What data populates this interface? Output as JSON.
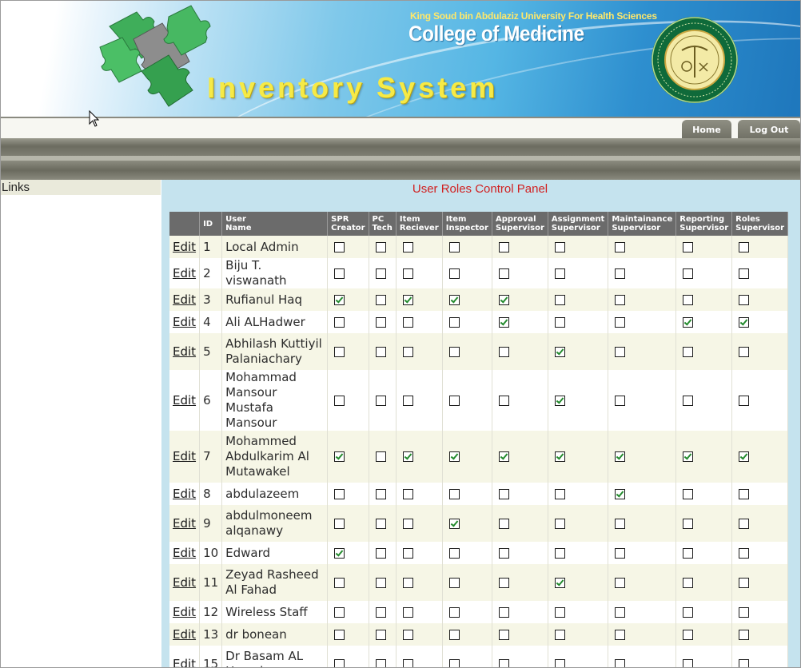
{
  "header": {
    "university": "King Soud bin Abdulaziz University For Health Sciences",
    "college": "College of Medicine",
    "system_title": "Inventory System",
    "logo_icon": "puzzle-pieces-icon",
    "seal_icon": "university-seal-icon"
  },
  "nav": {
    "tabs": [
      {
        "label": "Home"
      },
      {
        "label": "Log Out"
      }
    ]
  },
  "sidebar": {
    "title": "Links"
  },
  "main": {
    "title": "User Roles Control Panel",
    "columns": [
      "",
      "ID",
      "User Name",
      "SPR Creator",
      "PC Tech",
      "Item Reciever",
      "Item Inspector",
      "Approval Supervisor",
      "Assignment Supervisor",
      "Maintainance Supervisor",
      "Reporting Supervisor",
      "Roles Supervisor"
    ],
    "edit_label": "Edit",
    "rows": [
      {
        "id": "1",
        "name": "Local Admin",
        "roles": [
          0,
          0,
          0,
          0,
          0,
          0,
          0,
          0,
          0
        ]
      },
      {
        "id": "2",
        "name": "Biju T. viswanath",
        "roles": [
          0,
          0,
          0,
          0,
          0,
          0,
          0,
          0,
          0
        ]
      },
      {
        "id": "3",
        "name": "Rufianul Haq",
        "roles": [
          1,
          0,
          1,
          1,
          1,
          0,
          0,
          0,
          0
        ]
      },
      {
        "id": "4",
        "name": "Ali ALHadwer",
        "roles": [
          0,
          0,
          0,
          0,
          1,
          0,
          0,
          1,
          1
        ]
      },
      {
        "id": "5",
        "name": "Abhilash Kuttiyil Palaniachary",
        "roles": [
          0,
          0,
          0,
          0,
          0,
          1,
          0,
          0,
          0
        ]
      },
      {
        "id": "6",
        "name": "Mohammad Mansour Mustafa Mansour",
        "roles": [
          0,
          0,
          0,
          0,
          0,
          1,
          0,
          0,
          0
        ]
      },
      {
        "id": "7",
        "name": "Mohammed Abdulkarim Al Mutawakel",
        "roles": [
          1,
          0,
          1,
          1,
          1,
          1,
          1,
          1,
          1
        ]
      },
      {
        "id": "8",
        "name": "abdulazeem",
        "roles": [
          0,
          0,
          0,
          0,
          0,
          0,
          1,
          0,
          0
        ]
      },
      {
        "id": "9",
        "name": "abdulmoneem alqanawy",
        "roles": [
          0,
          0,
          0,
          1,
          0,
          0,
          0,
          0,
          0
        ]
      },
      {
        "id": "10",
        "name": "Edward",
        "roles": [
          1,
          0,
          0,
          0,
          0,
          0,
          0,
          0,
          0
        ]
      },
      {
        "id": "11",
        "name": "Zeyad Rasheed Al Fahad",
        "roles": [
          0,
          0,
          0,
          0,
          0,
          1,
          0,
          0,
          0
        ]
      },
      {
        "id": "12",
        "name": "Wireless Staff",
        "roles": [
          0,
          0,
          0,
          0,
          0,
          0,
          0,
          0,
          0
        ]
      },
      {
        "id": "13",
        "name": "dr bonean",
        "roles": [
          0,
          0,
          0,
          0,
          0,
          0,
          0,
          0,
          0
        ]
      },
      {
        "id": "15",
        "name": "Dr Basam AL Hemsi",
        "roles": [
          0,
          0,
          0,
          0,
          0,
          0,
          0,
          0,
          0
        ]
      }
    ]
  },
  "colors": {
    "header_row": "#6b6b6b",
    "row_odd": "#f6f6e6",
    "row_even": "#ffffff",
    "main_bg": "#c5e3ee",
    "panel_title": "#d12020",
    "check_mark": "#238a2d"
  }
}
